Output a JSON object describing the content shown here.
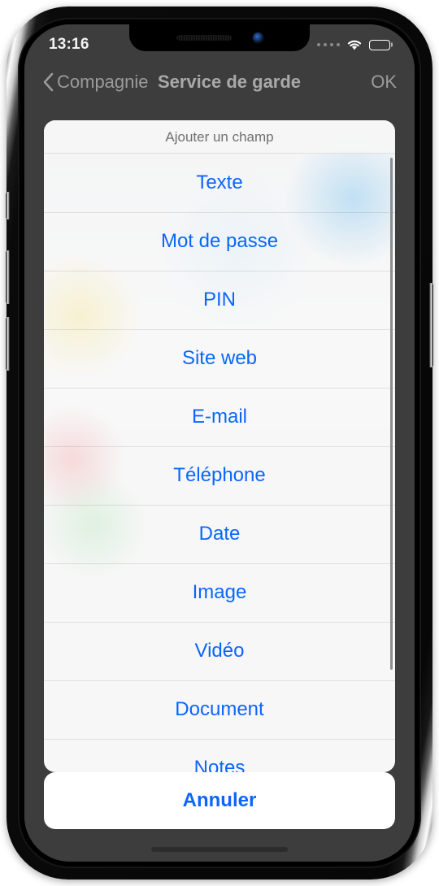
{
  "status_bar": {
    "time": "13:16",
    "cellular_icon": "cellular-dots-icon",
    "wifi_icon": "wifi-icon",
    "battery_icon": "battery-full-icon"
  },
  "nav_bar": {
    "back_chevron_icon": "chevron-left-icon",
    "back_label": "Compagnie",
    "title": "Service de garde",
    "done_label": "OK"
  },
  "action_sheet": {
    "header": "Ajouter un champ",
    "options": [
      {
        "label": "Texte"
      },
      {
        "label": "Mot de passe"
      },
      {
        "label": "PIN"
      },
      {
        "label": "Site web"
      },
      {
        "label": "E-mail"
      },
      {
        "label": "Téléphone"
      },
      {
        "label": "Date"
      },
      {
        "label": "Image"
      },
      {
        "label": "Vidéo"
      },
      {
        "label": "Document"
      },
      {
        "label": "Notes"
      }
    ],
    "cancel_label": "Annuler"
  },
  "colors": {
    "accent_blue": "#0a66ff",
    "header_gray": "#6f6f6f",
    "nav_gray": "#9b9b9b",
    "sheet_bg": "#f7f7f7",
    "dimmed_app_bg": "#3d3d3d"
  },
  "device": {
    "notch_speaker_icon": "speaker-grille-icon",
    "notch_camera_icon": "front-camera-icon",
    "home_indicator_icon": "home-indicator-icon"
  }
}
